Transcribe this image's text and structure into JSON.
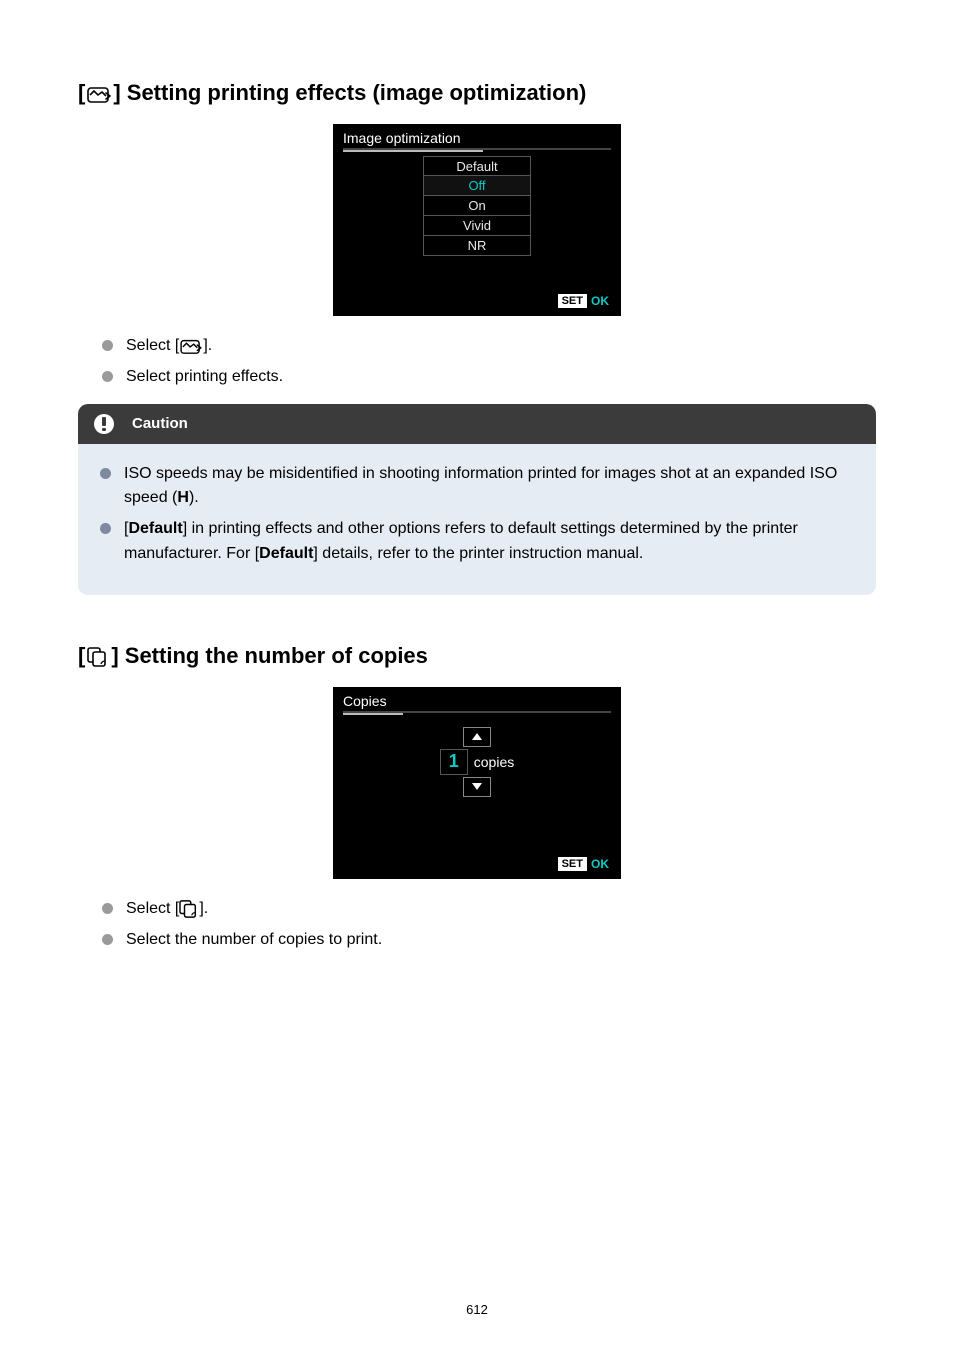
{
  "section1": {
    "title_text": "] Setting printing effects (image optimization)",
    "title_bracket_open": "[",
    "icon_name": "image-optimization-icon",
    "lcd": {
      "title": "Image optimization",
      "options": [
        "Default",
        "Off",
        "On",
        "Vivid",
        "NR"
      ],
      "selected_index": 1,
      "set_label": "SET",
      "ok_label": "OK"
    },
    "bullets": {
      "b1_prefix": "Select [",
      "b1_suffix": "].",
      "b2": "Select printing effects."
    }
  },
  "caution": {
    "header": "Caution",
    "item1_a": "ISO speeds may be misidentified in shooting information printed for images shot at an expanded ISO speed (",
    "item1_bold": "H",
    "item1_b": ").",
    "item2_a": "[",
    "item2_bold1": "Default",
    "item2_b": "] in printing effects and other options refers to default settings determined by the printer manufacturer. For [",
    "item2_bold2": "Default",
    "item2_c": "] details, refer to the printer instruction manual."
  },
  "section2": {
    "title_text": "] Setting the number of copies",
    "title_bracket_open": "[",
    "icon_name": "copies-icon",
    "lcd": {
      "title": "Copies",
      "value": "1",
      "unit": "copies",
      "set_label": "SET",
      "ok_label": "OK"
    },
    "bullets": {
      "b1_prefix": "Select [",
      "b1_suffix": "].",
      "b2": "Select the number of copies to print."
    }
  },
  "page_number": "612"
}
